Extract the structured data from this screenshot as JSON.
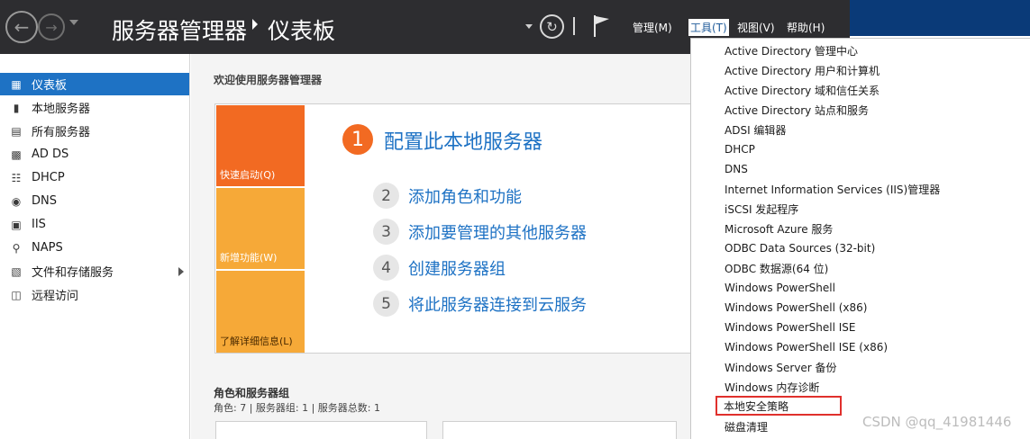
{
  "header": {
    "app_title": "服务器管理器",
    "page_title": "仪表板",
    "menus": [
      "管理(M)",
      "工具(T)",
      "视图(V)",
      "帮助(H)"
    ],
    "active_menu": "工具(T)"
  },
  "sidebar": {
    "items": [
      {
        "label": "仪表板",
        "icon": "dashboard-icon"
      },
      {
        "label": "本地服务器",
        "icon": "server-icon"
      },
      {
        "label": "所有服务器",
        "icon": "servers-icon"
      },
      {
        "label": "AD DS",
        "icon": "directory-icon"
      },
      {
        "label": "DHCP",
        "icon": "network-icon"
      },
      {
        "label": "DNS",
        "icon": "dns-icon"
      },
      {
        "label": "IIS",
        "icon": "iis-icon"
      },
      {
        "label": "NAPS",
        "icon": "key-icon"
      },
      {
        "label": "文件和存储服务",
        "icon": "storage-icon"
      },
      {
        "label": "远程访问",
        "icon": "remote-icon"
      }
    ],
    "selected": "仪表板"
  },
  "main": {
    "welcome": "欢迎使用服务器管理器",
    "tiles": [
      "快速启动(Q)",
      "新增功能(W)",
      "了解详细信息(L)"
    ],
    "steps": [
      {
        "num": "1",
        "text": "配置此本地服务器"
      },
      {
        "num": "2",
        "text": "添加角色和功能"
      },
      {
        "num": "3",
        "text": "添加要管理的其他服务器"
      },
      {
        "num": "4",
        "text": "创建服务器组"
      },
      {
        "num": "5",
        "text": "将此服务器连接到云服务"
      }
    ],
    "roles_title": "角色和服务器组",
    "roles_summary": "角色: 7 | 服务器组: 1 | 服务器总数: 1"
  },
  "tools_menu": {
    "items": [
      "Active Directory 管理中心",
      "Active Directory 用户和计算机",
      "Active Directory 域和信任关系",
      "Active Directory 站点和服务",
      "ADSI 编辑器",
      "DHCP",
      "DNS",
      "Internet Information Services (IIS)管理器",
      "iSCSI 发起程序",
      "Microsoft Azure 服务",
      "ODBC Data Sources (32-bit)",
      "ODBC 数据源(64 位)",
      "Windows PowerShell",
      "Windows PowerShell (x86)",
      "Windows PowerShell ISE",
      "Windows PowerShell ISE (x86)",
      "Windows Server 备份",
      "Windows 内存诊断",
      "本地安全策略",
      "磁盘清理"
    ],
    "highlighted": "本地安全策略"
  },
  "watermark": "CSDN @qq_41981446",
  "colors": {
    "titlebar": "#2d2d30",
    "selection": "#1e72c4",
    "quick_start": "#f26a22",
    "tile_accent": "#f6a938",
    "highlight_box": "#e0302c"
  }
}
